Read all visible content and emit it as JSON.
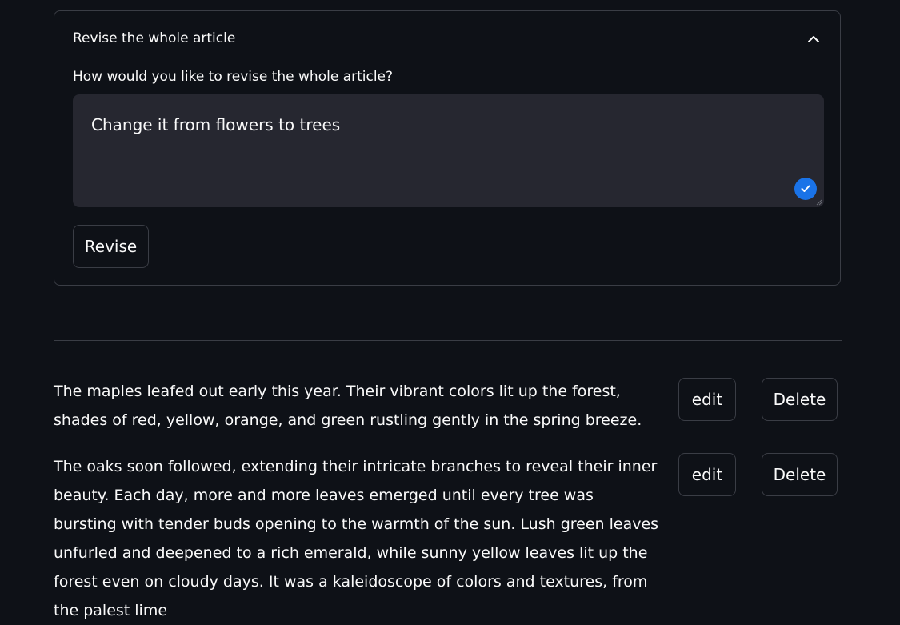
{
  "expander": {
    "title": "Revise the whole article",
    "toggle_icon": "chevron-up-icon",
    "prompt_label": "How would you like to revise the whole article?",
    "prompt_value": "Change it from flowers to trees",
    "submit_icon": "check-icon",
    "revise_label": "Revise"
  },
  "colors": {
    "background": "#0e1117",
    "input_bg": "#262730",
    "border": "#3a3d45",
    "accent": "#1a73e8",
    "text": "#fafafa"
  },
  "paragraphs": [
    {
      "text": "The maples leafed out early this year. Their vibrant colors lit up the forest, shades of red, yellow, orange, and green rustling gently in the spring breeze.",
      "edit_label": "edit",
      "delete_label": "Delete"
    },
    {
      "text": "The oaks soon followed, extending their intricate branches to reveal their inner beauty. Each day, more and more leaves emerged until every tree was bursting with tender buds opening to the warmth of the sun. Lush green leaves unfurled and deepened to a rich emerald, while sunny yellow leaves lit up the forest even on cloudy days. It was a kaleidoscope of colors and textures, from the palest lime",
      "edit_label": "edit",
      "delete_label": "Delete"
    }
  ]
}
